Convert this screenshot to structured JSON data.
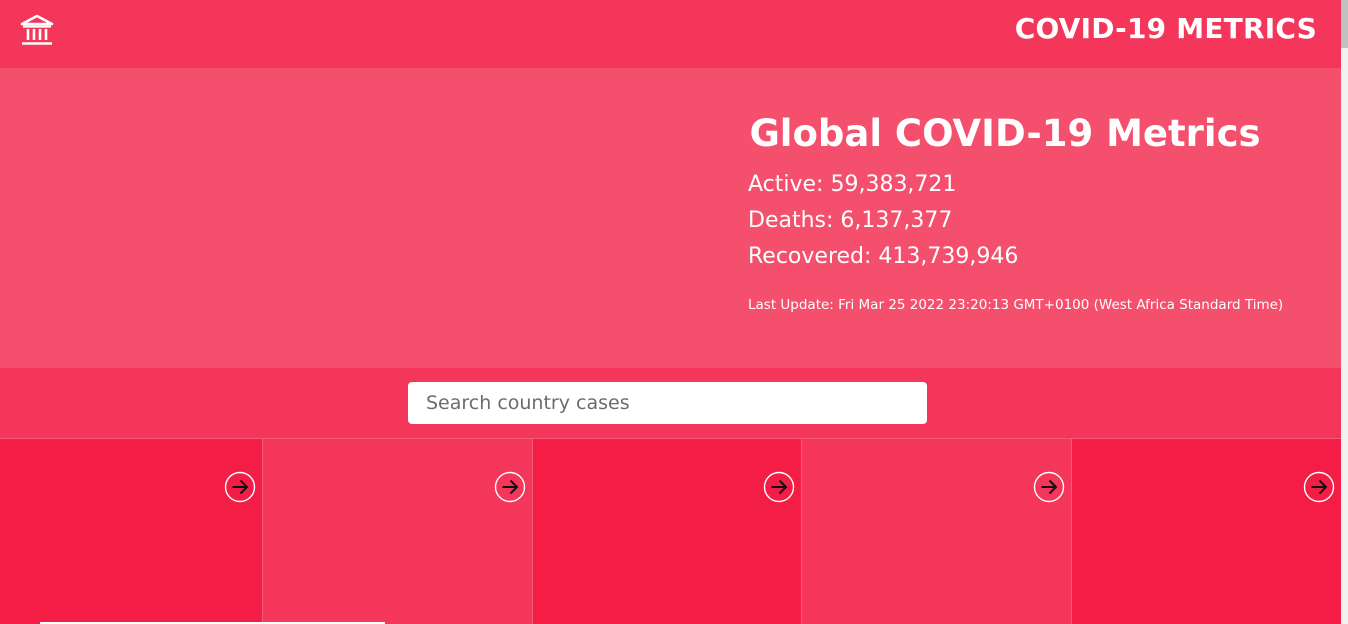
{
  "header": {
    "brand": "COVID-19 METRICS",
    "logo_icon": "bank-building-icon"
  },
  "hero": {
    "title": "Global COVID-19 Metrics",
    "active": "Active: 59,383,721",
    "deaths": "Deaths: 6,137,377",
    "recovered": "Recovered: 413,739,946",
    "last_update": "Last Update: Fri Mar 25 2022 23:20:13 GMT+0100 (West Africa Standard Time)"
  },
  "search": {
    "placeholder": "Search country cases",
    "value": ""
  },
  "cards": [
    {
      "icon": "arrow-right-circle-icon"
    },
    {
      "icon": "arrow-right-circle-icon"
    },
    {
      "icon": "arrow-right-circle-icon"
    },
    {
      "icon": "arrow-right-circle-icon"
    },
    {
      "icon": "arrow-right-circle-icon"
    }
  ],
  "colors": {
    "primary": "#f3365a",
    "hero": "#f44f6d",
    "card_dark": "#f41d46",
    "card_light": "#f3365a"
  }
}
